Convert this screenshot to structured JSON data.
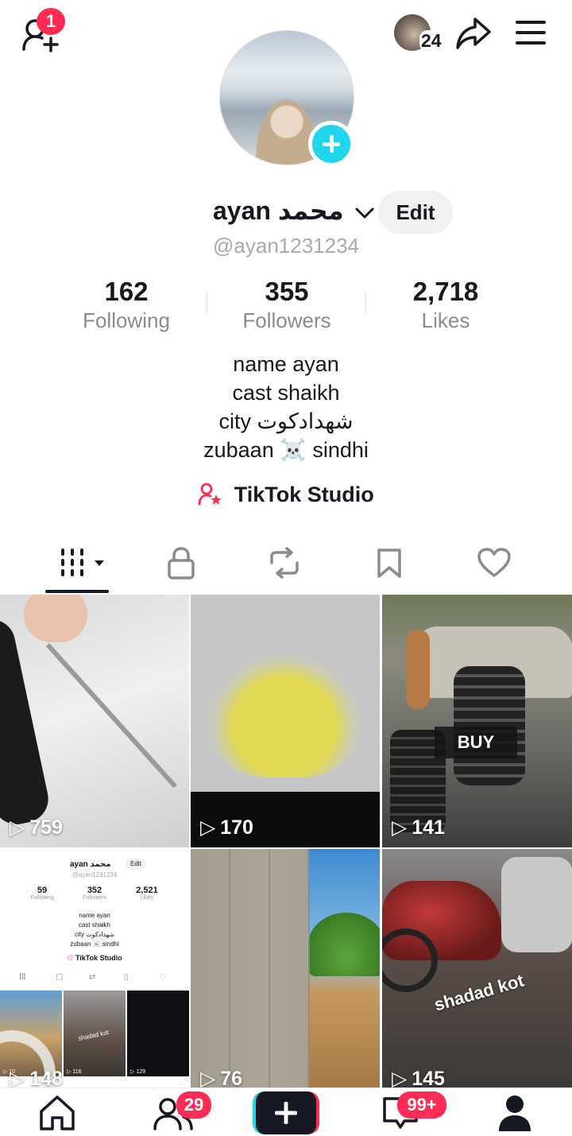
{
  "header": {
    "add_friends_badge": "1",
    "viewers_count": "24"
  },
  "profile": {
    "display_name": "ayan محمد",
    "edit_label": "Edit",
    "username": "@ayan1231234",
    "stats": [
      {
        "value": "162",
        "label": "Following"
      },
      {
        "value": "355",
        "label": "Followers"
      },
      {
        "value": "2,718",
        "label": "Likes"
      }
    ],
    "bio": [
      "name ayan",
      "cast shaikh",
      "city شھدادکوت",
      "zubaan ☠️ sindhi"
    ],
    "studio_label": "TikTok Studio"
  },
  "videos": [
    {
      "views": "759",
      "overlay_text": ""
    },
    {
      "views": "170",
      "overlay_text": ""
    },
    {
      "views": "141",
      "overlay_text": "BUY"
    },
    {
      "views": "148",
      "overlay_text": ""
    },
    {
      "views": "76",
      "overlay_text": ""
    },
    {
      "views": "145",
      "overlay_text": "shadad kot"
    }
  ],
  "thumb_profile": {
    "name": "ayan محمد",
    "edit": "Edit",
    "handle": "@ayan1231234",
    "stats": [
      {
        "value": "59",
        "label": "Following"
      },
      {
        "value": "352",
        "label": "Followers"
      },
      {
        "value": "2,521",
        "label": "Likes"
      }
    ],
    "bio": [
      "name ayan",
      "cast shaikh",
      "city شھدادکوت",
      "zubaan ☠️ sindhi"
    ],
    "studio": "TikTok Studio",
    "mini_views": [
      "10",
      "116",
      "129"
    ],
    "mini_caption": "shadad kot"
  },
  "bottom_nav": {
    "friends_badge": "29",
    "inbox_badge": "99+"
  },
  "colors": {
    "accent": "#fe2c55",
    "cyan": "#20d5ec",
    "text": "#161823",
    "muted": "#8a8b91"
  }
}
